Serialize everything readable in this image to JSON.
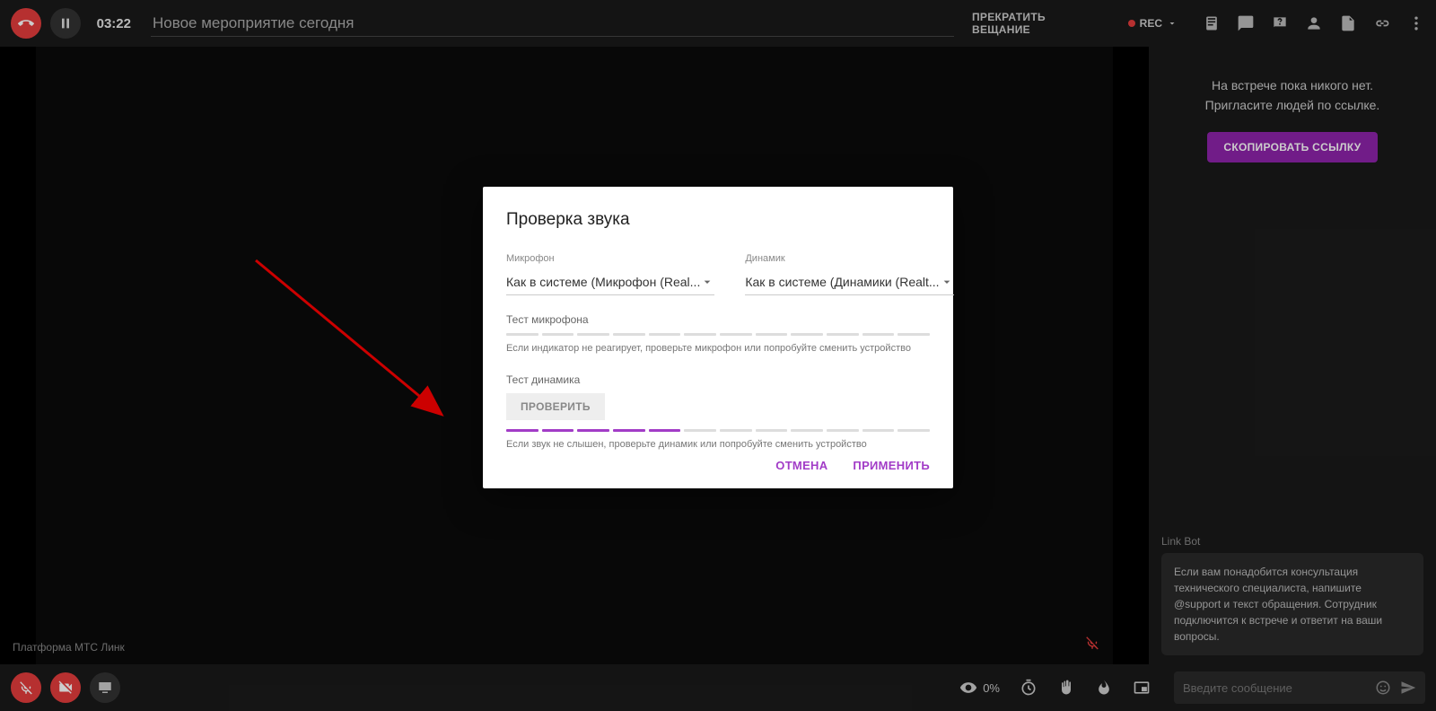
{
  "topbar": {
    "timer": "03:22",
    "title": "Новое мероприятие сегодня",
    "stop_broadcast": "ПРЕКРАТИТЬ ВЕЩАНИЕ",
    "rec_label": "REC"
  },
  "sidebar": {
    "empty_line1": "На встрече пока никого нет.",
    "empty_line2": "Пригласите людей по ссылке.",
    "copy_link": "СКОПИРОВАТЬ ССЫЛКУ",
    "bot_name": "Link Bot",
    "bot_text": "Если вам понадобится консультация технического специалиста, напишите @support и текст обращения. Сотрудник подключится к встрече и ответит на ваши вопросы."
  },
  "stage": {
    "watermark": "Платформа МТС Линк"
  },
  "bottombar": {
    "zoom": "0%",
    "chat_placeholder": "Введите сообщение"
  },
  "modal": {
    "title": "Проверка звука",
    "mic_label": "Микрофон",
    "mic_value": "Как в системе (Микрофон (Real...",
    "spk_label": "Динамик",
    "spk_value": "Как в системе (Динамики (Realt...",
    "mic_test_label": "Тест микрофона",
    "mic_hint": "Если индикатор не реагирует, проверьте микрофон или попробуйте сменить устройство",
    "spk_test_label": "Тест динамика",
    "check_button": "ПРОВЕРИТЬ",
    "spk_hint": "Если звук не слышен, проверьте динамик или попробуйте сменить устройство",
    "cancel": "ОТМЕНА",
    "apply": "ПРИМЕНИТЬ",
    "mic_level_segments": 12,
    "mic_level_active": 0,
    "spk_level_segments": 12,
    "spk_level_active": 5
  }
}
